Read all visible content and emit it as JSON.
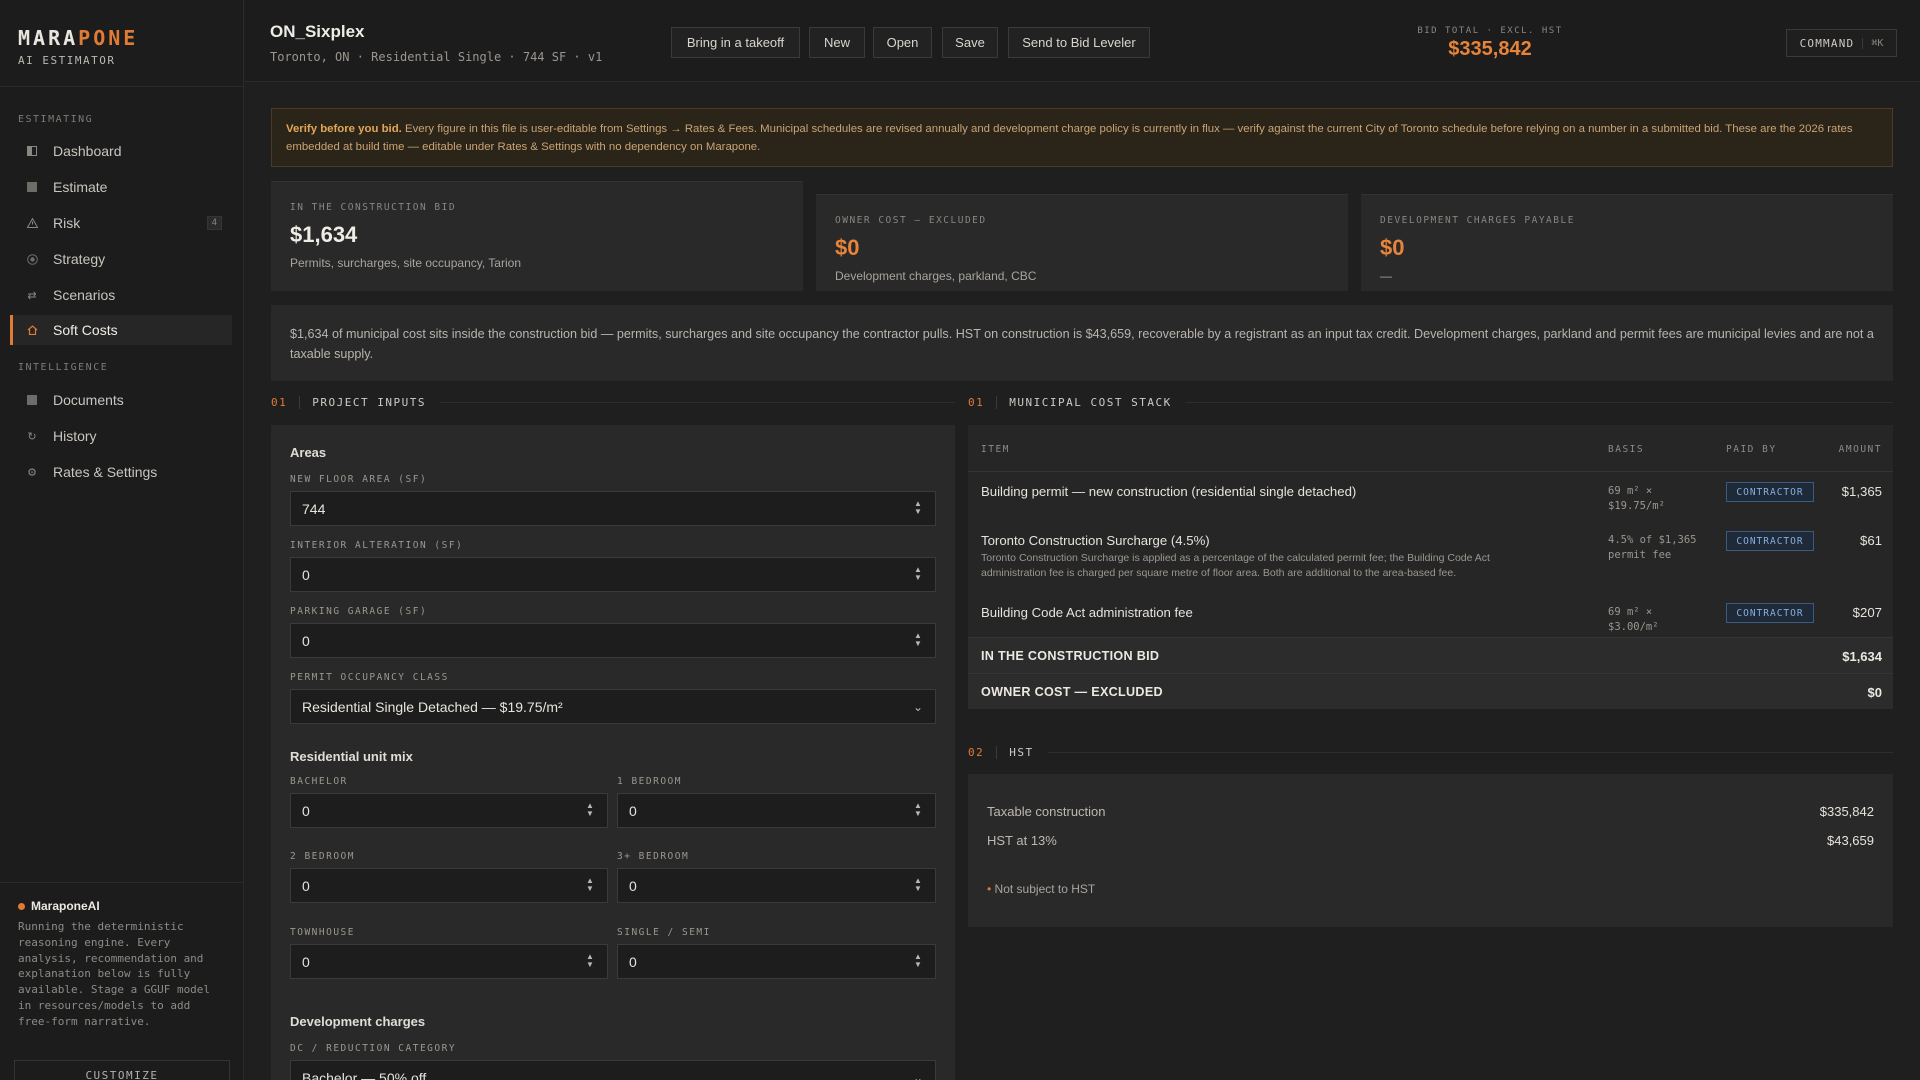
{
  "brand": {
    "name_part1": "MARA",
    "name_part2": "PONE",
    "subtitle": "AI ESTIMATOR"
  },
  "sidebar": {
    "section_estimating": "ESTIMATING",
    "section_intelligence": "INTELLIGENCE",
    "items": [
      {
        "label": "Dashboard",
        "icon": "dashboard-icon"
      },
      {
        "label": "Estimate",
        "icon": "estimate-icon"
      },
      {
        "label": "Risk",
        "icon": "warning-icon",
        "badge": "4"
      },
      {
        "label": "Strategy",
        "icon": "target-icon"
      },
      {
        "label": "Scenarios",
        "icon": "arrows-icon"
      },
      {
        "label": "Soft Costs",
        "icon": "home-icon",
        "active": true
      },
      {
        "label": "Documents",
        "icon": "document-icon"
      },
      {
        "label": "History",
        "icon": "history-icon"
      },
      {
        "label": "Rates & Settings",
        "icon": "gear-icon"
      }
    ],
    "ai": {
      "title": "MaraponeAI",
      "text": "Running the deterministic reasoning engine. Every analysis, recommendation and explanation below is fully available. Stage a GGUF model in resources/models to add free-form narrative."
    },
    "customize_label": "CUSTOMIZE"
  },
  "header": {
    "title": "ON_Sixplex",
    "subtitle": "Toronto, ON · Residential Single · 744 SF · v1",
    "buttons": {
      "takeoff": "Bring in a takeoff",
      "new": "New",
      "open": "Open",
      "save": "Save",
      "send": "Send to Bid Leveler"
    },
    "bid_total_label": "BID TOTAL · EXCL. HST",
    "bid_total_value": "$335,842",
    "command_label": "COMMAND",
    "command_shortcut": "⌘K"
  },
  "warning": {
    "bold": "Verify before you bid.",
    "text": " Every figure in this file is user-editable from Settings → Rates & Fees. Municipal schedules are revised annually and development charge policy is currently in flux — verify against the current City of Toronto schedule before relying on a number in a submitted bid. These are the 2026 rates embedded at build time — editable under Rates & Settings with no dependency on Marapone."
  },
  "cards": [
    {
      "label": "IN THE CONSTRUCTION BID",
      "value": "$1,634",
      "desc": "Permits, surcharges, site occupancy, Tarion",
      "color": "#f0ece6"
    },
    {
      "label": "OWNER COST — EXCLUDED",
      "value": "$0",
      "desc": "Development charges, parkland, CBC",
      "color": "#e8843a"
    },
    {
      "label": "DEVELOPMENT CHARGES PAYABLE",
      "value": "$0",
      "desc": "—",
      "color": "#e8843a"
    }
  ],
  "summary": "$1,634 of municipal cost sits inside the construction bid — permits, surcharges and site occupancy the contractor pulls. HST on construction is $43,659, recoverable by a registrant as an input tax credit. Development charges, parkland and permit fees are municipal levies and are not a taxable supply.",
  "inputs": {
    "section_num": "01",
    "section_title": "PROJECT INPUTS",
    "areas_title": "Areas",
    "new_floor_label": "NEW FLOOR AREA (SF)",
    "new_floor_value": "744",
    "interior_label": "INTERIOR ALTERATION (SF)",
    "interior_value": "0",
    "parking_label": "PARKING GARAGE (SF)",
    "parking_value": "0",
    "occupancy_label": "PERMIT OCCUPANCY CLASS",
    "occupancy_value": "Residential Single Detached — $19.75/m²",
    "unitmix_title": "Residential unit mix",
    "bachelor_label": "BACHELOR",
    "bachelor_value": "0",
    "one_bed_label": "1 BEDROOM",
    "one_bed_value": "0",
    "two_bed_label": "2 BEDROOM",
    "two_bed_value": "0",
    "three_bed_label": "3+ BEDROOM",
    "three_bed_value": "0",
    "townhouse_label": "TOWNHOUSE",
    "townhouse_value": "0",
    "single_label": "SINGLE / SEMI",
    "single_value": "0",
    "dc_title": "Development charges",
    "dc_label": "DC / REDUCTION CATEGORY",
    "dc_value": "Bachelor — 50% off"
  },
  "cost_stack": {
    "section_num": "01",
    "section_title": "MUNICIPAL COST STACK",
    "headers": {
      "item": "ITEM",
      "basis": "BASIS",
      "paid_by": "PAID BY",
      "amount": "AMOUNT"
    },
    "rows": [
      {
        "item": "Building permit — new construction (residential single detached)",
        "basis_line1": "69 m² ×",
        "basis_line2": "$19.75/m²",
        "paid_by": "CONTRACTOR",
        "amount": "$1,365"
      },
      {
        "item": "Toronto Construction Surcharge (4.5%)",
        "note": "Toronto Construction Surcharge is applied as a percentage of the calculated permit fee; the Building Code Act administration fee is charged per square metre of floor area. Both are additional to the area-based fee.",
        "basis_line1": "4.5% of $1,365",
        "basis_line2": "permit fee",
        "paid_by": "CONTRACTOR",
        "amount": "$61"
      },
      {
        "item": "Building Code Act administration fee",
        "basis_line1": "69 m² ×",
        "basis_line2": "$3.00/m²",
        "paid_by": "CONTRACTOR",
        "amount": "$207"
      }
    ],
    "total_in_bid_label": "IN THE CONSTRUCTION BID",
    "total_in_bid_value": "$1,634",
    "owner_cost_label": "OWNER COST — EXCLUDED",
    "owner_cost_value": "$0"
  },
  "hst": {
    "section_num": "02",
    "section_title": "HST",
    "taxable_label": "Taxable construction",
    "taxable_value": "$335,842",
    "rate_label": "HST at 13%",
    "rate_value": "$43,659",
    "note": "Not subject to HST"
  }
}
